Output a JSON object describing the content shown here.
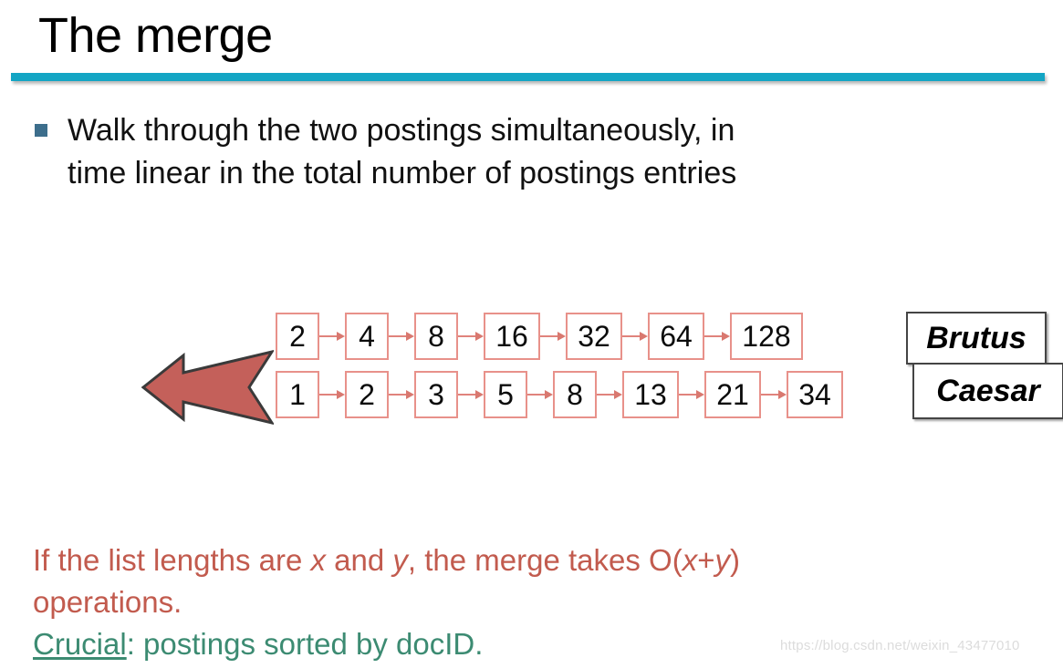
{
  "slide": {
    "title": "The merge",
    "accent_color": "#13A5C4",
    "bullet_marker_color": "#3D6E8C",
    "bullet": {
      "line1": "Walk through the two postings simultaneously, in",
      "line2": "time linear in the total number of postings entries",
      "full": "Walk through the two postings simultaneously, in time linear in the total number of postings entries"
    }
  },
  "diagram": {
    "arrow_name": "merge-direction-arrow",
    "arrow_direction": "left",
    "arrow_fill": "#C4605A",
    "arrow_stroke": "#3A3A3A",
    "cell_border_color": "#E8918A",
    "connector_color": "#D9786F",
    "postings": [
      {
        "term": "Brutus",
        "docids": [
          "2",
          "4",
          "8",
          "16",
          "32",
          "64",
          "128"
        ]
      },
      {
        "term": "Caesar",
        "docids": [
          "1",
          "2",
          "3",
          "5",
          "8",
          "13",
          "21",
          "34"
        ]
      }
    ]
  },
  "note": {
    "line1_a": "If the list lengths are ",
    "line1_x": "x",
    "line1_b": " and ",
    "line1_y": "y",
    "line1_c": ", the merge takes O(",
    "line1_x2": "x",
    "line1_d": "+",
    "line1_y2": "y",
    "line1_e": ")",
    "line2": "operations.",
    "line3_underlined": "Crucial",
    "line3_rest": ": postings sorted by docID.",
    "red_color": "#C25B4E",
    "green_color": "#3C8B72"
  },
  "watermark": {
    "text": "https://blog.csdn.net/weixin_43477010"
  }
}
